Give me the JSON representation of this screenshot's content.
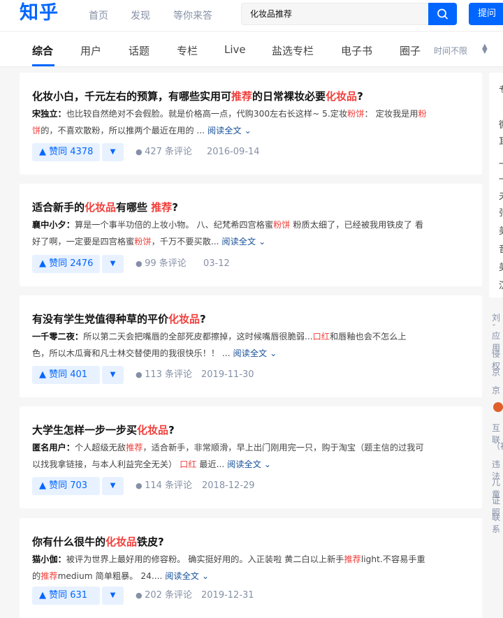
{
  "header": {
    "logo": "知乎",
    "nav": [
      "首页",
      "发现",
      "等你来答"
    ],
    "search_value": "化妆品推荐",
    "ask_label": "提问",
    "brand_color": "#0066ff"
  },
  "tabs": {
    "items": [
      "综合",
      "用户",
      "话题",
      "专栏",
      "Live",
      "盐选专栏",
      "电子书",
      "圈子"
    ],
    "active": "综合",
    "time_filter": "时间不限"
  },
  "results": [
    {
      "title": [
        [
          "化妆小白，千元左右的预算，有哪些实用可",
          false
        ],
        [
          "推荐",
          true
        ],
        [
          "的日常裸妆必要",
          false
        ],
        [
          "化妆品",
          true
        ],
        [
          "?",
          false
        ]
      ],
      "author": "宋独立：",
      "line1": [
        [
          "也比较自然绝对不会假脸。就是价格高一点，代购300左右长这样~ 5.定妆",
          false
        ],
        [
          "粉饼",
          true
        ],
        [
          "： 定妆我是用",
          false
        ],
        [
          "粉",
          true
        ]
      ],
      "line2": [
        [
          "饼",
          true
        ],
        [
          "的，不喜欢散粉，所以推两个最近在用的 ...",
          false
        ]
      ],
      "read_more": "阅读全文",
      "votes": "赞同 4378",
      "comments": "427 条评论",
      "date": "2016-09-14"
    },
    {
      "title": [
        [
          "适合新手的",
          false
        ],
        [
          "化妆品",
          true
        ],
        [
          "有哪些 ",
          false
        ],
        [
          "推荐",
          true
        ],
        [
          "?",
          false
        ]
      ],
      "author": "襄中小夕：",
      "line1": [
        [
          "算是一个事半功倍的上妆小物。 八、纪梵希四宫格蜜",
          false
        ],
        [
          "粉饼",
          true
        ],
        [
          " 粉质太细了，已经被我用铁皮了 看",
          false
        ]
      ],
      "line2": [
        [
          "好了啊，一定要是四宫格蜜",
          false
        ],
        [
          "粉饼",
          true
        ],
        [
          "，千万不要买散...",
          false
        ]
      ],
      "read_more": "阅读全文",
      "votes": "赞同 2476",
      "comments": "99 条评论",
      "date": "03-12"
    },
    {
      "title": [
        [
          "有没有学生党值得种草的平价",
          false
        ],
        [
          "化妆品",
          true
        ],
        [
          "?",
          false
        ]
      ],
      "author": "一千零二夜：",
      "line1": [
        [
          "所以第二天会把嘴唇的全部死皮都擦掉，这时候嘴唇很脆弱...",
          false
        ],
        [
          "口红",
          true
        ],
        [
          "和唇釉也会不怎么上",
          false
        ]
      ],
      "line2": [
        [
          "色，所以木瓜膏和凡士林交替使用的我很快乐！！ ...",
          false
        ]
      ],
      "read_more": "阅读全文",
      "votes": "赞同 401",
      "comments": "113 条评论",
      "date": "2019-11-30"
    },
    {
      "title": [
        [
          "大学生怎样一步一步买",
          false
        ],
        [
          "化妆品",
          true
        ],
        [
          "?",
          false
        ]
      ],
      "author": "匿名用户：",
      "line1": [
        [
          "个人超级无敌",
          false
        ],
        [
          "推荐",
          true
        ],
        [
          "，适合新手，非常顺滑，早上出门刚用完一只，购于淘宝（题主信的过我可",
          false
        ]
      ],
      "line2": [
        [
          "以找我拿链接，与本人利益完全无关） ",
          false
        ],
        [
          "口红",
          true
        ],
        [
          " 最近...",
          false
        ]
      ],
      "read_more": "阅读全文",
      "votes": "赞同 703",
      "comments": "114 条评论",
      "date": "2018-12-29"
    },
    {
      "title": [
        [
          "你有什么很牛的",
          false
        ],
        [
          "化妆品",
          true
        ],
        [
          "铁皮?",
          false
        ]
      ],
      "author": "猫小伽：",
      "line1": [
        [
          "被评为世界上最好用的修容粉。 确实挺好用的。入正装啦 黄二白以上新手",
          false
        ],
        [
          "推荐",
          true
        ],
        [
          "light.不容易手重",
          false
        ]
      ],
      "line2": [
        [
          "的",
          false
        ],
        [
          "推荐",
          true
        ],
        [
          "medium 简单粗暴。 24....",
          false
        ]
      ],
      "read_more": "阅读全文",
      "votes": "赞同 631",
      "comments": "202 条评论",
      "date": "2019-12-31"
    }
  ],
  "sidebar": {
    "card_fragments": [
      "专",
      "微",
      "耳",
      "一",
      "一",
      "夫",
      "张",
      "美",
      "音",
      "美",
      "沉"
    ],
    "link_fragments": [
      "刘ˇ",
      "应用",
      "侵权",
      "京",
      "京",
      "互联",
      "（初",
      "违法",
      "儿童",
      "证照",
      "联系"
    ]
  },
  "colors": {
    "highlight": "#f1403c",
    "link": "#175199",
    "muted": "#8590a6"
  }
}
